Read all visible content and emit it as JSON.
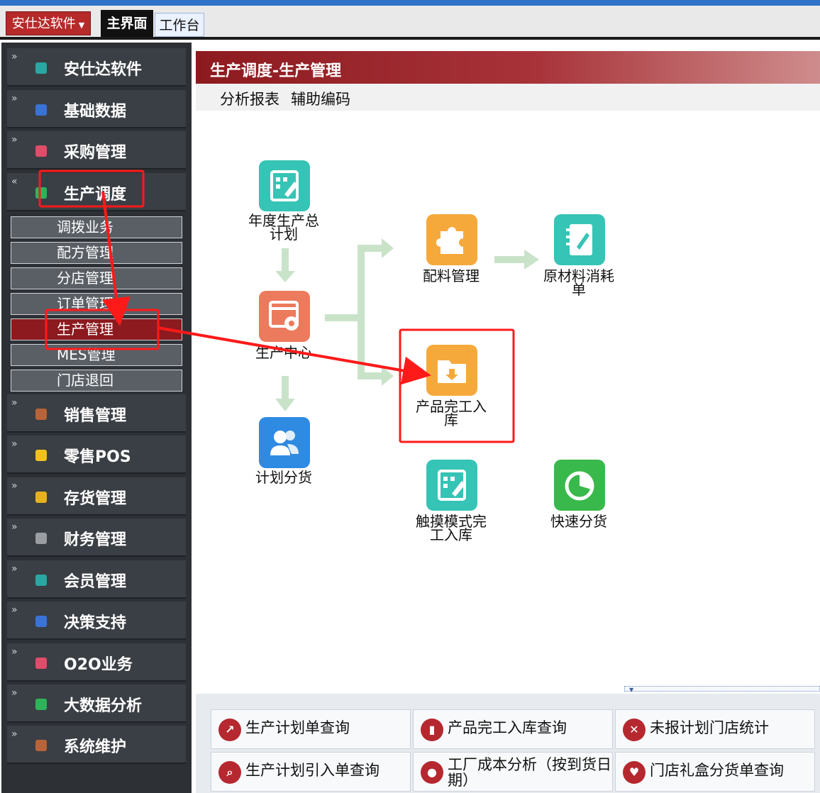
{
  "header": {
    "app_menu_label": "安仕达软件",
    "tabs": [
      {
        "label": "主界面"
      },
      {
        "label": "工作台"
      }
    ]
  },
  "sidebar": {
    "items": [
      {
        "label": "安仕达软件",
        "icon": "teal-square-icon",
        "color": "#2aa7a0"
      },
      {
        "label": "基础数据",
        "icon": "blue-square-icon",
        "color": "#3a73d6"
      },
      {
        "label": "采购管理",
        "icon": "pink-square-icon",
        "color": "#e04c6a"
      },
      {
        "label": "生产调度",
        "icon": "green-square-icon",
        "color": "#2fb35a"
      },
      {
        "label": "销售管理",
        "icon": "brown-square-icon",
        "color": "#b8643a"
      },
      {
        "label": "零售POS",
        "icon": "yellow-square-icon",
        "color": "#f2c21c"
      },
      {
        "label": "存货管理",
        "icon": "gold-square-icon",
        "color": "#e8b21e"
      },
      {
        "label": "财务管理",
        "icon": "gray-square-icon",
        "color": "#9a9da2"
      },
      {
        "label": "会员管理",
        "icon": "teal-square-icon",
        "color": "#2aa7a0"
      },
      {
        "label": "决策支持",
        "icon": "blue-square-icon",
        "color": "#3a73d6"
      },
      {
        "label": "O2O业务",
        "icon": "pink-square-icon",
        "color": "#e04c6a"
      },
      {
        "label": "大数据分析",
        "icon": "green-square-icon",
        "color": "#2fb35a"
      },
      {
        "label": "系统维护",
        "icon": "brown-square-icon",
        "color": "#b8643a"
      }
    ],
    "sub_items": [
      {
        "label": "调拨业务"
      },
      {
        "label": "配方管理"
      },
      {
        "label": "分店管理"
      },
      {
        "label": "订单管理"
      },
      {
        "label": "生产管理"
      },
      {
        "label": "MES管理"
      },
      {
        "label": "门店退回"
      }
    ]
  },
  "panel": {
    "title": "生产调度-生产管理",
    "tabs": [
      {
        "label": "分析报表"
      },
      {
        "label": "辅助编码"
      }
    ]
  },
  "flow": {
    "nodes": [
      {
        "label1": "年度生产总",
        "label2": "计划",
        "icon": "edit-form-icon",
        "color": "#35c4b5"
      },
      {
        "label1": "生产中心",
        "label2": "",
        "icon": "gear-window-icon",
        "color": "#ec7a5c"
      },
      {
        "label1": "计划分货",
        "label2": "",
        "icon": "users-icon",
        "color": "#2f8ae2"
      },
      {
        "label1": "配料管理",
        "label2": "",
        "icon": "puzzle-icon",
        "color": "#f6a93b"
      },
      {
        "label1": "原材料消耗",
        "label2": "单",
        "icon": "notebook-icon",
        "color": "#35c4b5"
      },
      {
        "label1": "产品完工入",
        "label2": "库",
        "icon": "folder-download-icon",
        "color": "#f6a93b"
      },
      {
        "label1": "触摸模式完",
        "label2": "工入库",
        "icon": "edit-form-icon",
        "color": "#35c4b5"
      },
      {
        "label1": "快速分货",
        "label2": "",
        "icon": "pie-chart-icon",
        "color": "#39b94b"
      }
    ]
  },
  "shortcuts": [
    {
      "label": "生产计划单查询",
      "icon": "chart-growth-icon"
    },
    {
      "label": "产品完工入库查询",
      "icon": "bar-chart-icon"
    },
    {
      "label": "未报计划门店统计",
      "icon": "close-icon"
    },
    {
      "label": "生产计划引入单查询",
      "icon": "search-icon"
    },
    {
      "label1": "工厂成本分析（按到货日",
      "label2": "期）",
      "icon": "globe-icon"
    },
    {
      "label": "门店礼盒分货单查询",
      "icon": "heart-icon"
    }
  ],
  "colors": {
    "accent_red": "#8c1a1f",
    "annotation_red": "#ff1a1a",
    "flow_arrow": "#c9e3c9"
  }
}
